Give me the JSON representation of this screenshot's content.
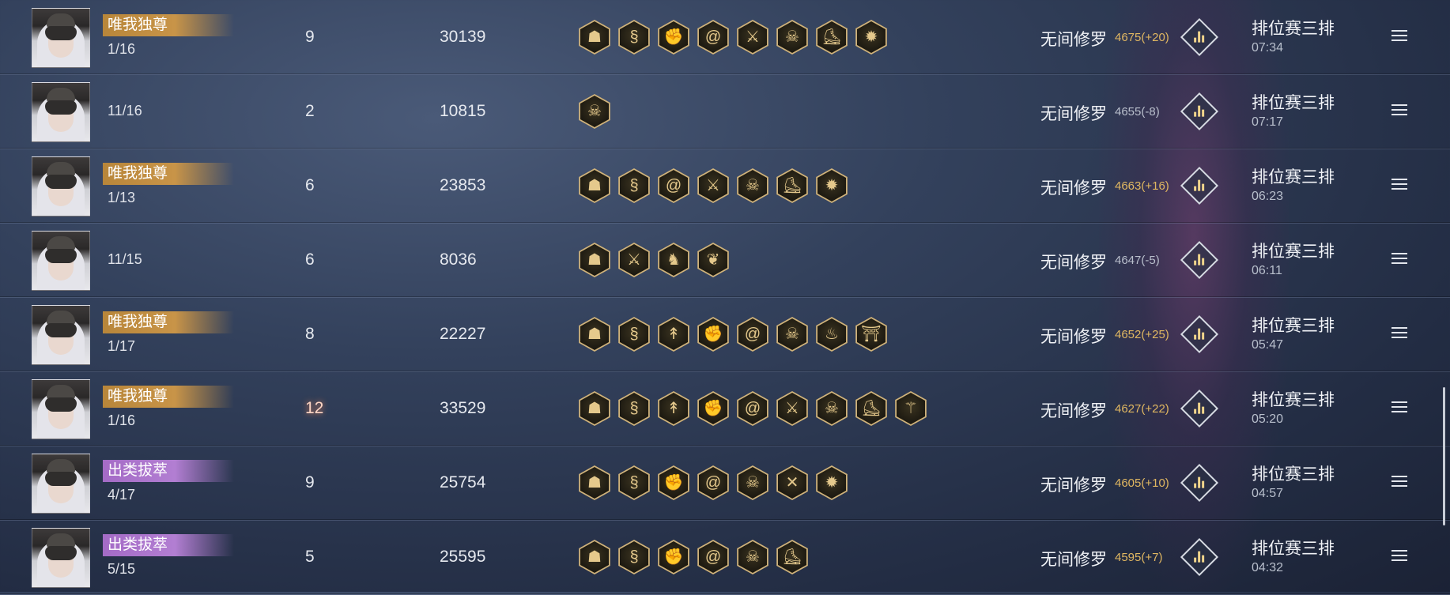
{
  "rows": [
    {
      "title": "唯我独尊",
      "title_color": "gold",
      "rank": "1/16",
      "kills": "9",
      "kills_hot": false,
      "score": "30139",
      "icons": [
        "oni-mask-icon",
        "coin-spiral-icon",
        "fist-icon",
        "swirl-icon",
        "blades-icon",
        "skull-icon",
        "boot-icon",
        "sun-wheel-icon"
      ],
      "mode": "无间修罗",
      "rating": "4675(+20)",
      "rating_up": true,
      "match_type": "排位赛三排",
      "time": "07:34"
    },
    {
      "title": "",
      "title_color": "",
      "rank": "11/16",
      "kills": "2",
      "kills_hot": false,
      "score": "10815",
      "icons": [
        "skull-icon"
      ],
      "mode": "无间修罗",
      "rating": "4655(-8)",
      "rating_up": false,
      "match_type": "排位赛三排",
      "time": "07:17"
    },
    {
      "title": "唯我独尊",
      "title_color": "gold",
      "rank": "1/13",
      "kills": "6",
      "kills_hot": false,
      "score": "23853",
      "icons": [
        "oni-mask-icon",
        "coin-spiral-icon",
        "swirl-icon",
        "blades-icon",
        "skull-icon",
        "boot-icon",
        "sun-wheel-icon"
      ],
      "mode": "无间修罗",
      "rating": "4663(+16)",
      "rating_up": true,
      "match_type": "排位赛三排",
      "time": "06:23"
    },
    {
      "title": "",
      "title_color": "",
      "rank": "11/15",
      "kills": "6",
      "kills_hot": false,
      "score": "8036",
      "icons": [
        "oni-mask-icon",
        "blades-icon",
        "horse-icon",
        "dragon-icon"
      ],
      "mode": "无间修罗",
      "rating": "4647(-5)",
      "rating_up": false,
      "match_type": "排位赛三排",
      "time": "06:11"
    },
    {
      "title": "唯我独尊",
      "title_color": "gold",
      "rank": "1/17",
      "kills": "8",
      "kills_hot": false,
      "score": "22227",
      "icons": [
        "oni-mask-icon",
        "coin-spiral-icon",
        "arrow-icon",
        "fist-icon",
        "swirl-icon",
        "skull-icon",
        "flame-icon",
        "pagoda-icon"
      ],
      "mode": "无间修罗",
      "rating": "4652(+25)",
      "rating_up": true,
      "match_type": "排位赛三排",
      "time": "05:47"
    },
    {
      "title": "唯我独尊",
      "title_color": "gold",
      "rank": "1/16",
      "kills": "12",
      "kills_hot": true,
      "score": "33529",
      "icons": [
        "oni-mask-icon",
        "coin-spiral-icon",
        "arrow-icon",
        "fist-icon",
        "swirl-icon",
        "blades-icon",
        "skull-icon",
        "boot-icon",
        "claw-icon"
      ],
      "mode": "无间修罗",
      "rating": "4627(+22)",
      "rating_up": true,
      "match_type": "排位赛三排",
      "time": "05:20"
    },
    {
      "title": "出类拔萃",
      "title_color": "purple",
      "rank": "4/17",
      "kills": "9",
      "kills_hot": false,
      "score": "25754",
      "icons": [
        "oni-mask-icon",
        "coin-spiral-icon",
        "fist-icon",
        "swirl-icon",
        "skull-icon",
        "cross-blades-icon",
        "sun-wheel-icon"
      ],
      "mode": "无间修罗",
      "rating": "4605(+10)",
      "rating_up": true,
      "match_type": "排位赛三排",
      "time": "04:57"
    },
    {
      "title": "出类拔萃",
      "title_color": "purple",
      "rank": "5/15",
      "kills": "5",
      "kills_hot": false,
      "score": "25595",
      "icons": [
        "oni-mask-icon",
        "coin-spiral-icon",
        "fist-icon",
        "swirl-icon",
        "skull-icon",
        "boot-icon"
      ],
      "mode": "无间修罗",
      "rating": "4595(+7)",
      "rating_up": true,
      "match_type": "排位赛三排",
      "time": "04:32"
    }
  ]
}
